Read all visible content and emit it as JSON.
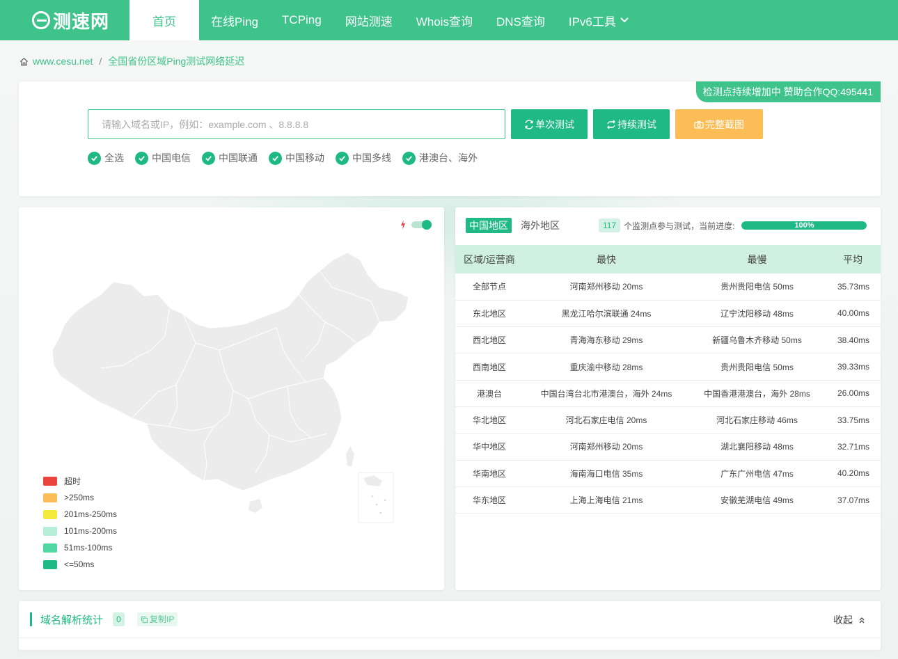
{
  "brand": {
    "logo_text": "测速网"
  },
  "nav": {
    "items": [
      {
        "label": "首页",
        "active": true
      },
      {
        "label": "在线Ping"
      },
      {
        "label": "TCPing"
      },
      {
        "label": "网站测速"
      },
      {
        "label": "Whois查询"
      },
      {
        "label": "DNS查询"
      },
      {
        "label": "IPv6工具",
        "has_dropdown": true
      }
    ]
  },
  "breadcrumb": {
    "home": "www.cesu.net",
    "separator": "/",
    "current": "全国省份区域Ping测试网络延迟"
  },
  "search": {
    "ribbon": "检测点持续增加中 赞助合作QQ:495441",
    "placeholder": "请输入域名或IP，例如：example.com 、8.8.8.8",
    "single_label": "单次测试",
    "continuous_label": "持续测试",
    "screenshot_label": "完整截图",
    "filters": [
      "全选",
      "中国电信",
      "中国联通",
      "中国移动",
      "中国多线",
      "港澳台、海外"
    ]
  },
  "map": {
    "legend": [
      {
        "label": "超时",
        "color": "#e9453e"
      },
      {
        "label": ">250ms",
        "color": "#fdbd56"
      },
      {
        "label": "201ms-250ms",
        "color": "#f5ea3c"
      },
      {
        "label": "101ms-200ms",
        "color": "#b6eed8"
      },
      {
        "label": "51ms-100ms",
        "color": "#4fd6a1"
      },
      {
        "label": "<=50ms",
        "color": "#1fb985"
      }
    ],
    "realtime_toggle_on": true,
    "colors": {
      "region_fill": "#ececec",
      "region_stroke": "#ffffff"
    }
  },
  "results": {
    "tab_china": "中国地区",
    "tab_overseas": "海外地区",
    "node_count": "117",
    "progress_label": "个监测点参与测试，当前进度:",
    "progress_text": "100%",
    "progress_value": 1.0,
    "headers": [
      "区域/运营商",
      "最快",
      "最慢",
      "平均"
    ],
    "rows": [
      [
        "全部节点",
        "河南郑州移动 20ms",
        "贵州贵阳电信 50ms",
        "35.73ms"
      ],
      [
        "东北地区",
        "黑龙江哈尔滨联通 24ms",
        "辽宁沈阳移动 48ms",
        "40.00ms"
      ],
      [
        "西北地区",
        "青海海东移动 29ms",
        "新疆乌鲁木齐移动 50ms",
        "38.40ms"
      ],
      [
        "西南地区",
        "重庆渝中移动 28ms",
        "贵州贵阳电信 50ms",
        "39.33ms"
      ],
      [
        "港澳台",
        "中国台湾台北市港澳台，海外 24ms",
        "中国香港港澳台，海外 28ms",
        "26.00ms"
      ],
      [
        "华北地区",
        "河北石家庄电信 20ms",
        "河北石家庄移动 46ms",
        "33.75ms"
      ],
      [
        "华中地区",
        "河南郑州移动 20ms",
        "湖北襄阳移动 48ms",
        "32.71ms"
      ],
      [
        "华南地区",
        "海南海口电信 35ms",
        "广东广州电信 47ms",
        "40.20ms"
      ],
      [
        "华东地区",
        "上海上海电信 21ms",
        "安徽芜湖电信 49ms",
        "37.07ms"
      ]
    ]
  },
  "dns": {
    "title": "域名解析统计",
    "count": "0",
    "copy_label": "复制IP",
    "collapse_label": "收起"
  },
  "colors": {
    "accent": "#3ec38b",
    "button": "#1fb985",
    "screenshot_button": "#fdbd56"
  }
}
